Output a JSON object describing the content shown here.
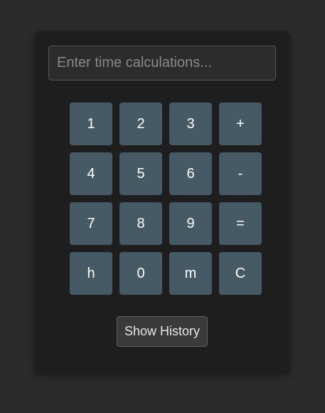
{
  "input": {
    "value": "",
    "placeholder": "Enter time calculations..."
  },
  "keypad": {
    "keys": [
      {
        "label": "1",
        "name": "key-1"
      },
      {
        "label": "2",
        "name": "key-2"
      },
      {
        "label": "3",
        "name": "key-3"
      },
      {
        "label": "+",
        "name": "key-plus"
      },
      {
        "label": "4",
        "name": "key-4"
      },
      {
        "label": "5",
        "name": "key-5"
      },
      {
        "label": "6",
        "name": "key-6"
      },
      {
        "label": "-",
        "name": "key-minus"
      },
      {
        "label": "7",
        "name": "key-7"
      },
      {
        "label": "8",
        "name": "key-8"
      },
      {
        "label": "9",
        "name": "key-9"
      },
      {
        "label": "=",
        "name": "key-equals"
      },
      {
        "label": "h",
        "name": "key-hours"
      },
      {
        "label": "0",
        "name": "key-0"
      },
      {
        "label": "m",
        "name": "key-minutes"
      },
      {
        "label": "C",
        "name": "key-clear"
      }
    ]
  },
  "history": {
    "button_label": "Show History"
  },
  "colors": {
    "background": "#2b2b2b",
    "panel": "#1e1e1e",
    "key": "#455a64",
    "key_text": "#ffffff"
  }
}
